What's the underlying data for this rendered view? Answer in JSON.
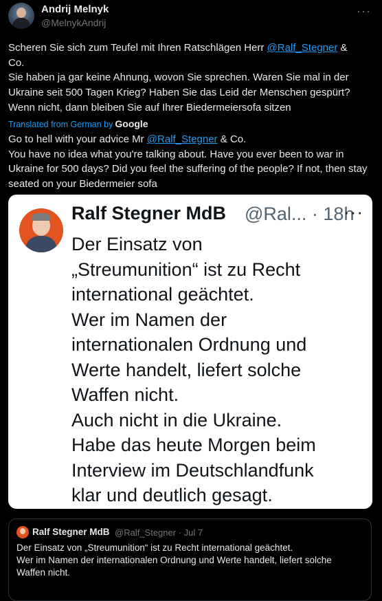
{
  "tweet": {
    "author_name": "Andrij Melnyk",
    "author_handle": "@MelnykAndrij",
    "more_icon": "more-horizontal-icon",
    "original": {
      "p1_before": "Scheren Sie sich zum Teufel mit Ihren Ratschlägen Herr ",
      "mention": "@Ralf_Stegner",
      "p1_after": " &",
      "p2": "Co.",
      "p3": "Sie haben ja gar keine Ahnung, wovon Sie sprechen. Waren Sie mal in der Ukraine seit 500 Tagen Krieg? Haben Sie das Leid der Menschen gespürt? Wenn nicht, dann bleiben Sie auf Ihrer Biedermeiersofa sitzen"
    },
    "translated_label": "Translated from German by",
    "translated_brand": "Google",
    "translation": {
      "p1_before": "Go to hell with your advice Mr ",
      "mention": "@Ralf_Stegner",
      "p1_after": " & Co.",
      "p2": "You have no idea what you're talking about. Have you ever been to war in Ukraine for 500 days? Did you feel the suffering of the people? If not, then stay seated on your Biedermeier sofa"
    }
  },
  "screenshot_card": {
    "name": "Ralf Stegner MdB",
    "handle_time": "@Ral... · 18h",
    "more_icon": "more-horizontal-icon",
    "lines": [
      "Der Einsatz von",
      "„Streumunition“ ist zu Recht",
      "international geächtet.",
      "Wer im Namen der",
      "internationalen Ordnung und",
      "Werte handelt, liefert solche",
      "Waffen nicht.",
      "Auch nicht in die Ukraine.",
      "Habe das heute Morgen beim",
      "Interview im Deutschlandfunk",
      "klar und deutlich gesagt."
    ]
  },
  "quoted_tweet": {
    "name": "Ralf Stegner MdB",
    "meta": "@Ralf_Stegner · Jul 7",
    "lines": [
      "Der Einsatz von „Streumunition“ ist zu Recht international geächtet.",
      "Wer im Namen der internationalen Ordnung und Werte handelt, liefert solche",
      "Waffen nicht."
    ]
  },
  "colors": {
    "background": "#000000",
    "text": "#e7e9ea",
    "secondary_text": "#71767b",
    "link": "#1d9bf0",
    "card_background": "#ffffff",
    "avatar_accent": "#e2541f"
  }
}
